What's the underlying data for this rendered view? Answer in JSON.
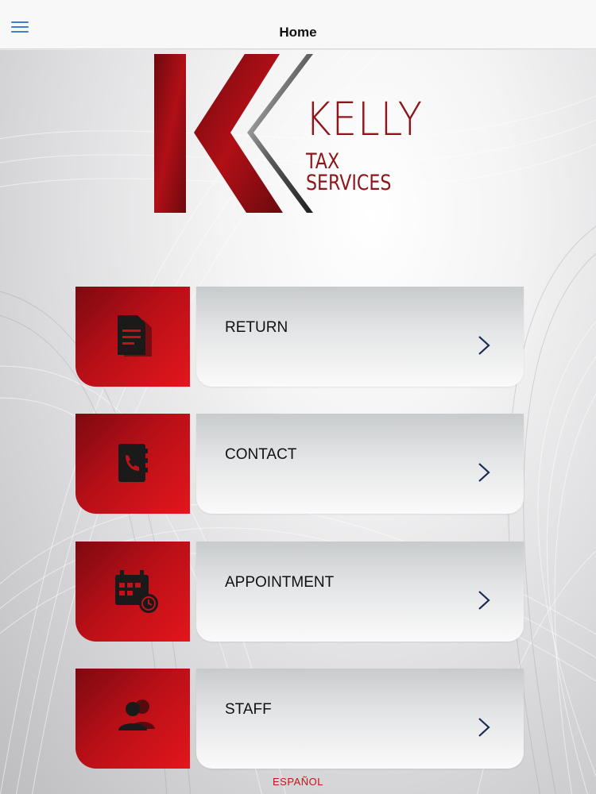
{
  "header": {
    "title": "Home",
    "menu_icon": "hamburger-menu-icon",
    "accent_color": "#3b7fd6"
  },
  "logo": {
    "name": "KELLY",
    "subtitle": "TAX SERVICES",
    "brand_color": "#8e1519"
  },
  "menu": {
    "items": [
      {
        "label": "RETURN",
        "icon": "document-icon"
      },
      {
        "label": "CONTACT",
        "icon": "phone-book-icon"
      },
      {
        "label": "APPOINTMENT",
        "icon": "calendar-clock-icon"
      },
      {
        "label": "STAFF",
        "icon": "people-icon"
      }
    ],
    "chevron_icon": "chevron-right-icon",
    "icon_tile_color": "#c0121a"
  },
  "footer": {
    "language_link": "ESPAÑOL"
  }
}
